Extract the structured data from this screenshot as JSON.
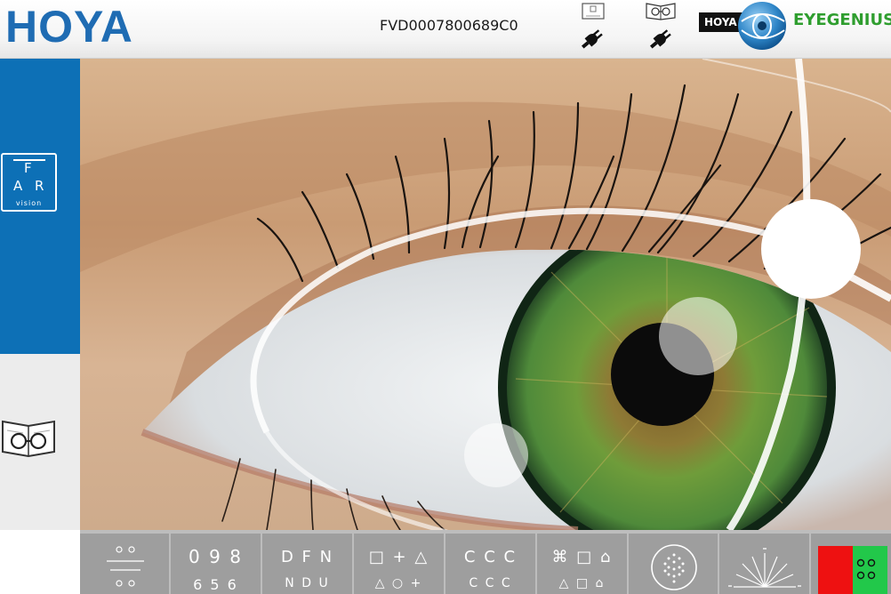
{
  "header": {
    "logo": "HOYA",
    "serial": "FVD0007800689C0",
    "brand_box": "HOYA",
    "brand_name": "EYEGENIUS",
    "icons": [
      "chart-screen-icon",
      "plug-icon",
      "reading-book-icon",
      "plug-icon"
    ]
  },
  "sidebar": {
    "far_button": {
      "letter_top": "F",
      "letter_left": "A",
      "letter_right": "R",
      "caption": "vision"
    },
    "near_button_icon": "book-glasses-icon",
    "colors": {
      "far_bg": "#0d70b6",
      "near_bg": "#ececec"
    }
  },
  "main": {
    "image": "green-eye-closeup-photo"
  },
  "toolbar": {
    "tools": [
      {
        "name": "tool-small-letters",
        "rows": [
          "",
          "",
          ""
        ]
      },
      {
        "name": "tool-numbers",
        "rows": [
          "0 9 8",
          "6 5 6"
        ]
      },
      {
        "name": "tool-letters",
        "rows": [
          "D F N",
          "N D U"
        ]
      },
      {
        "name": "tool-shapes",
        "rows": [
          "□ + △",
          "△ ○ +"
        ]
      },
      {
        "name": "tool-landolt-rings",
        "rows": [
          "C C C",
          "C C C"
        ]
      },
      {
        "name": "tool-symbols",
        "rows": [
          "⌘ □ ⌂",
          "△ □ ⌂"
        ]
      },
      {
        "name": "tool-dot-circle",
        "rows": []
      },
      {
        "name": "tool-astigmatism-fan",
        "rows": []
      },
      {
        "name": "tool-red-green",
        "rows": []
      }
    ],
    "colors": {
      "bg": "#9e9e9e",
      "red": "#ee1111",
      "green": "#22c84a"
    }
  }
}
